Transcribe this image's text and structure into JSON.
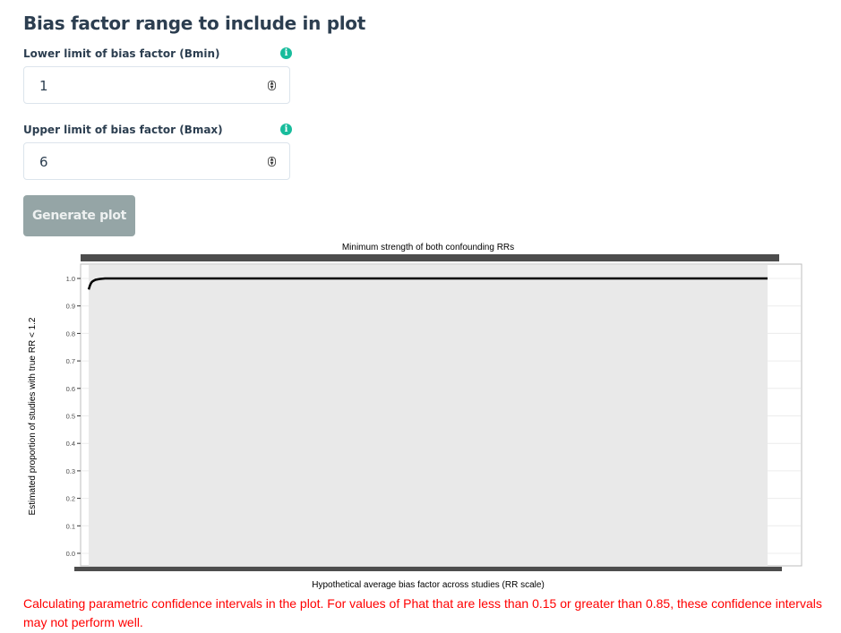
{
  "section": {
    "title": "Bias factor range to include in plot"
  },
  "fields": {
    "bmin": {
      "label": "Lower limit of bias factor (Bmin)",
      "value": "1",
      "info_icon": "info-circle-icon"
    },
    "bmax": {
      "label": "Upper limit of bias factor (Bmax)",
      "value": "6",
      "info_icon": "info-circle-icon"
    }
  },
  "button": {
    "label": "Generate plot",
    "color": "#95a5a6"
  },
  "colors": {
    "accent": "#18bc9c",
    "warning": "#ff0000"
  },
  "chart_data": {
    "type": "line",
    "title": "Minimum strength of both confounding RRs",
    "xlabel": "Hypothetical average bias factor across studies (RR scale)",
    "ylabel": "Estimated proportion of studies with true RR < 1.2",
    "ylim": [
      0,
      1
    ],
    "xlim": [
      1,
      6
    ],
    "y_ticks": [
      "0.0",
      "0.1",
      "0.2",
      "0.3",
      "0.4",
      "0.5",
      "0.6",
      "0.7",
      "0.8",
      "0.9",
      "1.0"
    ],
    "series": [
      {
        "x": [
          1,
          1.01,
          1.02,
          1.03,
          1.05,
          1.08,
          1.12,
          1.2,
          1.5,
          2,
          3,
          4,
          5,
          6
        ],
        "values": [
          0.96,
          0.975,
          0.985,
          0.99,
          0.995,
          0.998,
          1.0,
          1.0,
          1.0,
          1.0,
          1.0,
          1.0,
          1.0,
          1.0
        ]
      }
    ],
    "grid": true
  },
  "warning_text": "Calculating parametric confidence intervals in the plot. For values of Phat that are less than 0.15 or greater than 0.85, these confidence intervals may not perform well."
}
